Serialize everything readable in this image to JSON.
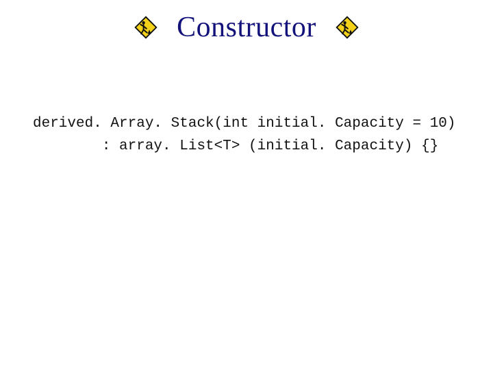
{
  "title": "Constructor",
  "icon_left": "construction-sign",
  "icon_right": "construction-sign",
  "code": {
    "line1": "derived. Array. Stack(int initial. Capacity = 10)",
    "line2": "        : array. List<T> (initial. Capacity) {}"
  }
}
